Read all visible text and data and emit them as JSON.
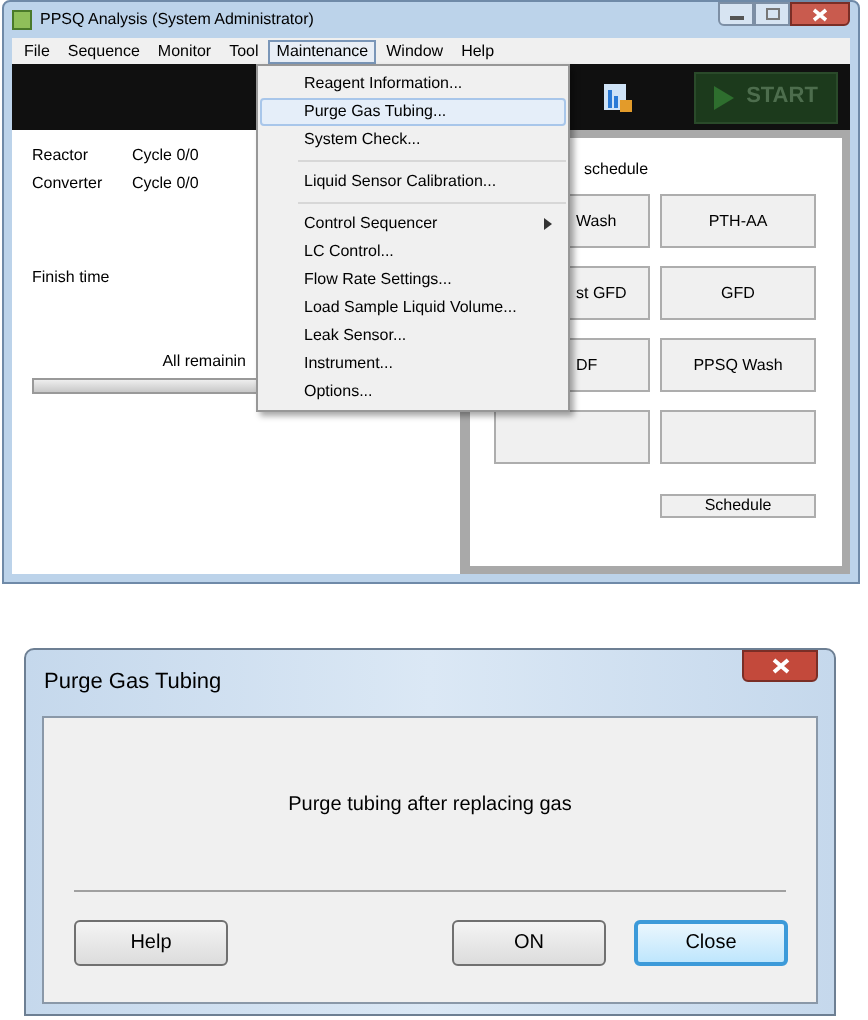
{
  "window": {
    "title": "PPSQ Analysis (System Administrator)"
  },
  "menubar": [
    {
      "label": "File",
      "selected": false
    },
    {
      "label": "Sequence",
      "selected": false
    },
    {
      "label": "Monitor",
      "selected": false
    },
    {
      "label": "Tool",
      "selected": false
    },
    {
      "label": "Maintenance",
      "selected": true
    },
    {
      "label": "Window",
      "selected": false
    },
    {
      "label": "Help",
      "selected": false
    }
  ],
  "toolbar": {
    "start_button": "START"
  },
  "status": {
    "rows": [
      {
        "label": "Reactor",
        "value": "Cycle 0/0"
      },
      {
        "label": "Converter",
        "value": "Cycle 0/0"
      }
    ],
    "finish_label": "Finish time",
    "remaining_label": "All remainin",
    "progress": {
      "level": 0
    }
  },
  "schedule": {
    "title": "schedule",
    "buttons": [
      {
        "kind": "covered",
        "label": "Wash"
      },
      {
        "kind": "plain",
        "label": "PTH-AA"
      },
      {
        "kind": "covered",
        "label": "st GFD"
      },
      {
        "kind": "plain",
        "label": "GFD"
      },
      {
        "kind": "covered",
        "label": "DF"
      },
      {
        "kind": "plain",
        "label": "PPSQ Wash"
      },
      {
        "kind": "plain"
      },
      {
        "kind": "plain"
      }
    ],
    "schedule_button": "Schedule"
  },
  "menu": [
    {
      "kind": "item",
      "label": "Reagent Information...",
      "selected": false
    },
    {
      "kind": "item",
      "label": "Purge Gas Tubing...",
      "selected": true
    },
    {
      "kind": "item",
      "label": "System Check...",
      "selected": false
    },
    {
      "kind": "separator"
    },
    {
      "kind": "item",
      "label": "Liquid Sensor Calibration...",
      "selected": false
    },
    {
      "kind": "separator"
    },
    {
      "kind": "submenu",
      "label": "Control Sequencer",
      "selected": false
    },
    {
      "kind": "item",
      "label": "LC Control...",
      "selected": false
    },
    {
      "kind": "item",
      "label": "Flow Rate Settings...",
      "selected": false
    },
    {
      "kind": "item",
      "label": "Load Sample Liquid Volume...",
      "selected": false
    },
    {
      "kind": "item",
      "label": "Leak Sensor...",
      "selected": false
    },
    {
      "kind": "item",
      "label": "Instrument...",
      "selected": false
    },
    {
      "kind": "item",
      "label": "Options...",
      "selected": false
    }
  ],
  "dialog": {
    "title": "Purge Gas Tubing",
    "message": "Purge tubing after replacing gas",
    "buttons": [
      {
        "label": "Help",
        "selected": false
      },
      {
        "label": "ON",
        "selected": false
      },
      {
        "label": "Close",
        "selected": true
      }
    ]
  }
}
